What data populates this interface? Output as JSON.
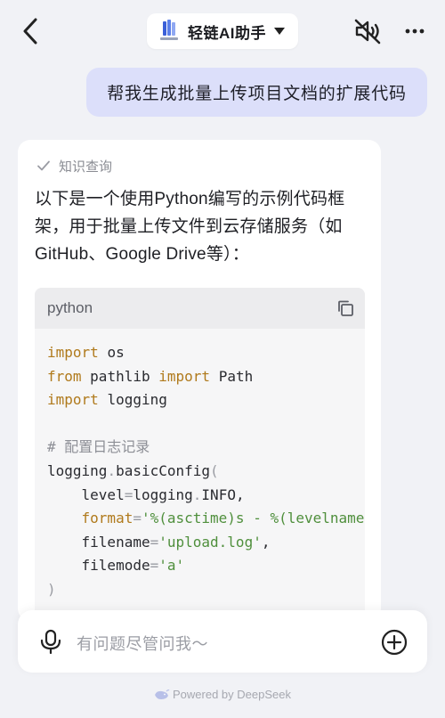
{
  "header": {
    "title": "轻链AI助手"
  },
  "conversation": {
    "user_message": "帮我生成批量上传项目文档的扩展代码",
    "answer": {
      "knowledge_query_label": "知识查询",
      "intro_text": "以下是一个使用Python编写的示例代码框架，用于批量上传文件到云存储服务（如GitHub、Google Drive等）：",
      "code": {
        "language": "python",
        "lines": [
          "import os",
          "from pathlib import Path",
          "import logging",
          "",
          "# 配置日志记录",
          "logging.basicConfig(",
          "    level=logging.INFO,",
          "    format='%(asctime)s - %(levelname)s - %(message)s',",
          "    filename='upload.log',",
          "    filemode='a'",
          ")"
        ]
      }
    }
  },
  "input": {
    "placeholder": "有问题尽管问我～"
  },
  "footer": {
    "powered_by": "Powered by DeepSeek"
  },
  "colors": {
    "background": "#f1f2f6",
    "user_bubble": "#dcdffa",
    "keyword": "#b07a1c",
    "string": "#4f8f3c",
    "comment": "#8d8f96"
  }
}
